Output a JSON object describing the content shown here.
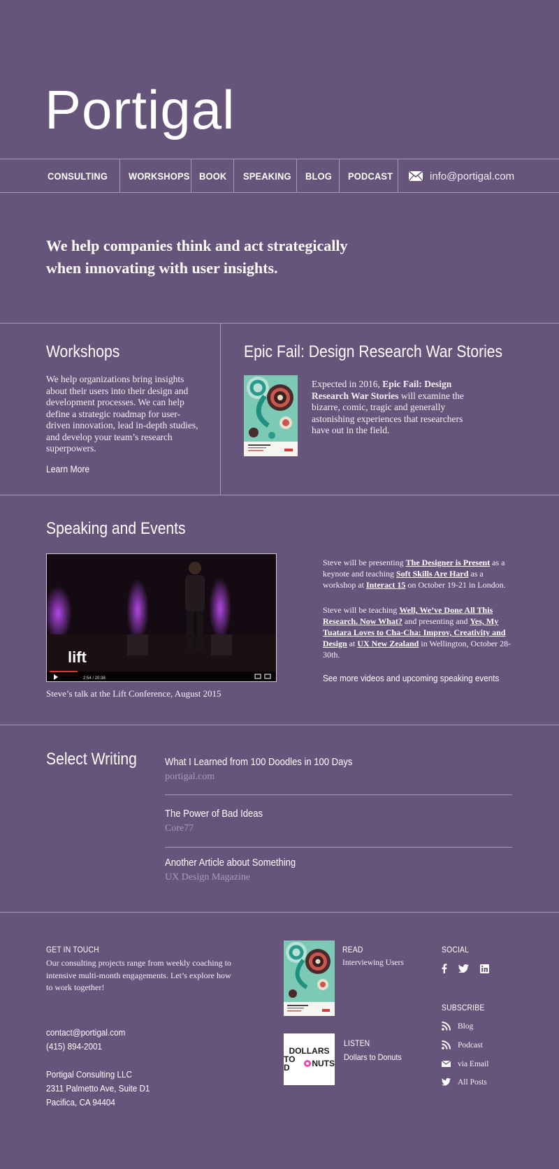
{
  "header": {
    "logo": "Portigal",
    "nav": [
      "CONSULTING",
      "WORKSHOPS",
      "BOOK",
      "SPEAKING",
      "BLOG",
      "PODCAST"
    ],
    "email": "info@portigal.com"
  },
  "hero": {
    "tagline_line1": "We help companies think and act strategically",
    "tagline_line2": "when innovating with user insights."
  },
  "workshops": {
    "title": "Workshops",
    "body": "We help organizations bring insights about their users into their design and development processes. We can help define a strategic roadmap for user-driven innovation, lead in-depth studies, and develop your team’s research superpowers.",
    "link": "Learn More"
  },
  "book": {
    "title": "Epic Fail: Design Research War Stories",
    "body_prefix": "Expected in 2016, ",
    "body_bold": "Epic Fail: Design Research War Stories",
    "body_suffix": " will examine the bizarre, comic, tragic and generally astonishing experiences that researchers have out in the field.",
    "cover_text1": "INTERVIEWING USERS",
    "cover_text2": "How to Uncover Compelling Insights",
    "cover_text3": "STEVE PORTIGAL",
    "cover_publisher": "Rosenfeld"
  },
  "speaking": {
    "title": "Speaking and Events",
    "video_logo": "lift",
    "video_time": "2:54 / 20:38",
    "caption": "Steve’s talk at the Lift Conference, August 2015",
    "p1": {
      "t1": "Steve will be presenting ",
      "l1": "The Designer is Present",
      "t2": " as a keynote and teaching ",
      "l2": "Soft Skills Are Hard",
      "t3": " as a workshop at ",
      "l3": "Interact 15",
      "t4": " on October 19-21 in London."
    },
    "p2": {
      "t1": "Steve will be teaching ",
      "l1": "Well, We’ve Done All This Research. Now What?",
      "t2": " and presenting and ",
      "l2": "Yes, My Tuatara Loves to Cha-Cha: Improv, Creativity and Design",
      "t3": " at ",
      "l3": "UX New Zealand",
      "t4": " in Wellington, October 28-30th."
    },
    "more": "See more videos and upcoming speaking events"
  },
  "writing": {
    "title": "Select Writing",
    "items": [
      {
        "title": "What I Learned from 100 Doodles in 100 Days",
        "source": "portigal.com"
      },
      {
        "title": "The Power of Bad Ideas",
        "source": "Core77"
      },
      {
        "title": "Another Article about Something",
        "source": "UX Design Magazine"
      }
    ]
  },
  "footer": {
    "contact_head": "GET IN TOUCH",
    "contact_body": "Our consulting projects range from weekly coaching to intensive multi-month engagements. Let’s explore how to work together!",
    "contact_email": "contact@portigal.com",
    "contact_phone": "(415) 894-2001",
    "company": "Portigal Consulting LLC",
    "address1": "2311 Palmetto Ave, Suite D1",
    "address2": "Pacifica, CA 94404",
    "read_head": "READ",
    "read_title": "Interviewing Users",
    "listen_head": "LISTEN",
    "listen_title": "Dollars to Donuts",
    "podcast_logo_line1": "DOLLARS",
    "podcast_logo_line2": "TO D",
    "podcast_logo_line3": "NUTS",
    "social_head": "SOCIAL",
    "subscribe_head": "SUBSCRIBE",
    "subscribe": [
      "Blog",
      "Podcast",
      "via Email",
      "All Posts"
    ]
  }
}
